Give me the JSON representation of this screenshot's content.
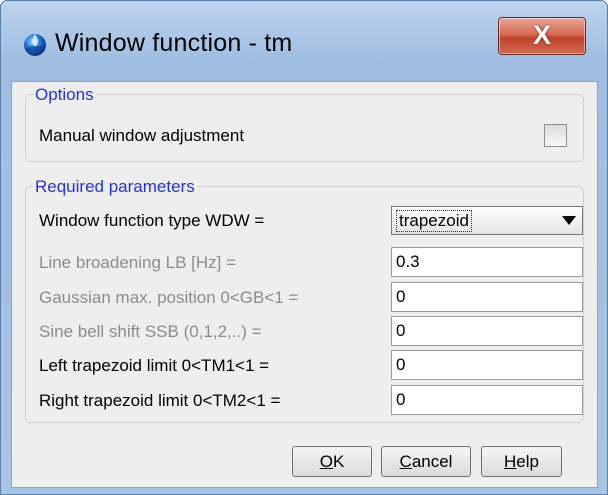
{
  "window": {
    "title": "Window function - tm",
    "close_label": "X"
  },
  "options": {
    "group_title": "Options",
    "manual_label": "Manual window adjustment",
    "manual_checked": false
  },
  "params": {
    "group_title": "Required parameters",
    "wdw_label": "Window function type WDW =",
    "wdw_value": "trapezoid",
    "rows": [
      {
        "label": "Line broadening LB [Hz] =",
        "value": "0.3",
        "enabled": false
      },
      {
        "label": "Gaussian max. position 0<GB<1 =",
        "value": "0",
        "enabled": false
      },
      {
        "label": "Sine bell shift SSB (0,1,2,..) =",
        "value": "0",
        "enabled": false
      },
      {
        "label": "Left trapezoid limit 0<TM1<1 =",
        "value": "0",
        "enabled": true
      },
      {
        "label": "Right trapezoid limit 0<TM2<1 =",
        "value": "0",
        "enabled": true
      }
    ]
  },
  "buttons": {
    "ok_mnemonic": "O",
    "ok_rest": "K",
    "cancel_mnemonic": "C",
    "cancel_rest": "ancel",
    "help_mnemonic": "H",
    "help_rest": "elp"
  }
}
